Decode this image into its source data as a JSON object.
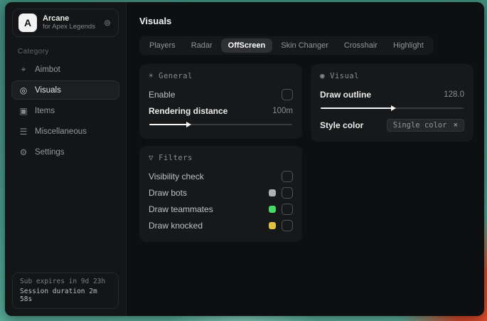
{
  "colors": {
    "backdrop_teal": "#4a9a8b",
    "backdrop_red": "#d94a2c",
    "swatch_gray": "#aeb0b2",
    "swatch_green": "#42d966",
    "swatch_yellow": "#e2c041"
  },
  "brand": {
    "logo_letter": "A",
    "title": "Arcane",
    "subtitle": "for Apex Legends",
    "action_icon_glyph": "⊚"
  },
  "sidebar": {
    "section_label": "Category",
    "items": [
      {
        "label": "Aimbot",
        "icon": "crosshair-icon",
        "glyph": "⌖"
      },
      {
        "label": "Visuals",
        "icon": "scan-eye-icon",
        "glyph": "◎",
        "selected": true
      },
      {
        "label": "Items",
        "icon": "box-icon",
        "glyph": "▣"
      },
      {
        "label": "Miscellaneous",
        "icon": "sliders-icon",
        "glyph": "☰"
      },
      {
        "label": "Settings",
        "icon": "gear-icon",
        "glyph": "⚙"
      }
    ],
    "footer": {
      "line1": "Sub expires in 9d 23h",
      "line2": "Session duration 2m 58s"
    }
  },
  "main": {
    "title": "Visuals",
    "tabs": [
      {
        "label": "Players"
      },
      {
        "label": "Radar"
      },
      {
        "label": "OffScreen",
        "selected": true
      },
      {
        "label": "Skin Changer"
      },
      {
        "label": "Crosshair"
      },
      {
        "label": "Highlight"
      }
    ],
    "general": {
      "title": "General",
      "icon_glyph": "☀",
      "enable_label": "Enable",
      "enable_checked": false,
      "distance_label": "Rendering distance",
      "distance_value": "100m"
    },
    "visual": {
      "title": "Visual",
      "icon_glyph": "◉",
      "outline_label": "Draw outline",
      "outline_value": "128.0",
      "style_label": "Style color",
      "style_value": "Single color",
      "remove_glyph": "×"
    },
    "filters": {
      "title": "Filters",
      "icon_glyph": "▽",
      "rows": [
        {
          "label": "Visibility check",
          "checked": false
        },
        {
          "label": "Draw bots",
          "swatch": "#aeb0b2",
          "checked": false
        },
        {
          "label": "Draw teammates",
          "swatch": "#42d966",
          "checked": false
        },
        {
          "label": "Draw knocked",
          "swatch": "#e2c041",
          "checked": false
        }
      ]
    }
  }
}
